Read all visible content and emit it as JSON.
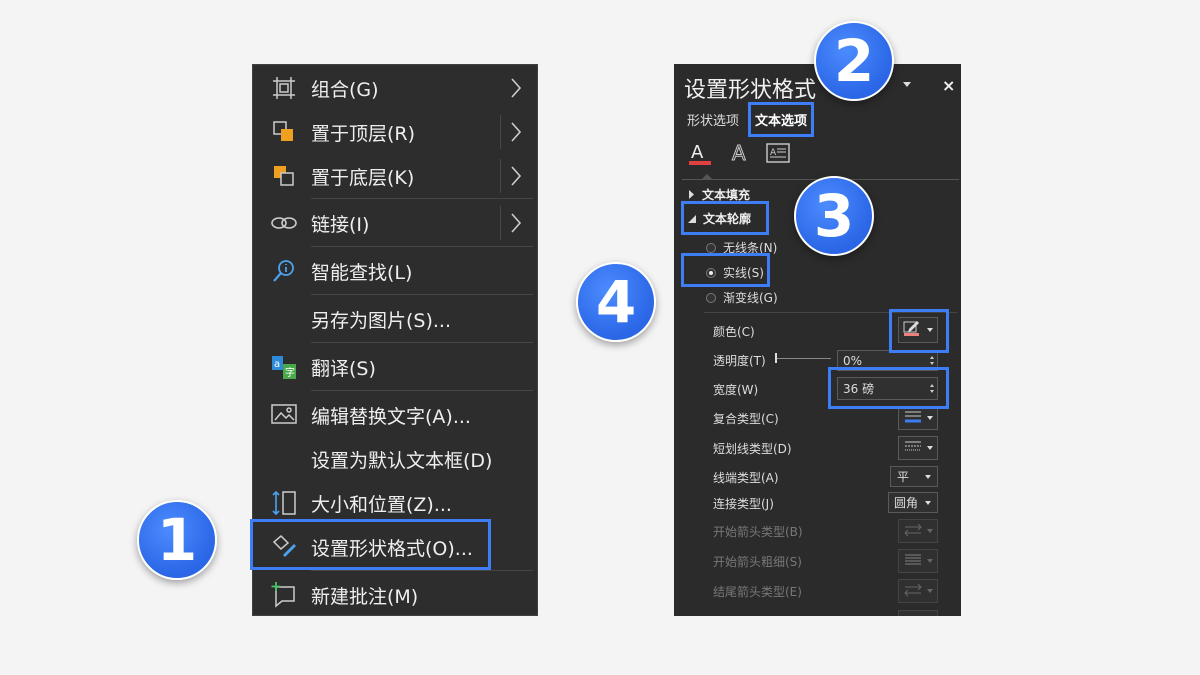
{
  "context_menu": {
    "items": [
      {
        "label": "组合(G)",
        "icon": "group-icon",
        "submenu": true
      },
      {
        "label": "置于顶层(R)",
        "icon": "bring-to-front-icon",
        "submenu": true
      },
      {
        "label": "置于底层(K)",
        "icon": "send-to-back-icon",
        "submenu": true
      },
      {
        "label": "链接(I)",
        "icon": "link-icon",
        "submenu": true
      },
      {
        "label": "智能查找(L)",
        "icon": "smart-lookup-icon",
        "submenu": false
      },
      {
        "label": "另存为图片(S)...",
        "icon": "",
        "submenu": false
      },
      {
        "label": "翻译(S)",
        "icon": "translate-icon",
        "submenu": false
      },
      {
        "label": "编辑替换文字(A)...",
        "icon": "alt-text-icon",
        "submenu": false
      },
      {
        "label": "设置为默认文本框(D)",
        "icon": "",
        "submenu": false
      },
      {
        "label": "大小和位置(Z)...",
        "icon": "size-position-icon",
        "submenu": false
      },
      {
        "label": "设置形状格式(O)...",
        "icon": "format-shape-icon",
        "submenu": false
      },
      {
        "label": "新建批注(M)",
        "icon": "new-comment-icon",
        "submenu": false
      }
    ]
  },
  "format_pane": {
    "title": "设置形状格式",
    "close": "×",
    "tabs": [
      {
        "label": "形状选项",
        "active": false
      },
      {
        "label": "文本选项",
        "active": true
      }
    ],
    "icons": [
      "text-fill-outline-icon",
      "text-effects-icon",
      "textbox-icon"
    ],
    "sections": {
      "text_fill": "文本填充",
      "text_outline": "文本轮廓"
    },
    "radios": [
      {
        "label": "无线条(N)",
        "checked": false
      },
      {
        "label": "实线(S)",
        "checked": true
      },
      {
        "label": "渐变线(G)",
        "checked": false
      }
    ],
    "props": {
      "color": {
        "label": "颜色(C)"
      },
      "transparency": {
        "label": "透明度(T)",
        "value": "0%"
      },
      "width": {
        "label": "宽度(W)",
        "value": "36 磅"
      },
      "compound": {
        "label": "复合类型(C)"
      },
      "dash": {
        "label": "短划线类型(D)"
      },
      "cap": {
        "label": "线端类型(A)",
        "value": "平"
      },
      "join": {
        "label": "连接类型(J)",
        "value": "圆角"
      },
      "begin_arrow_type": {
        "label": "开始箭头类型(B)"
      },
      "begin_arrow_size": {
        "label": "开始箭头粗细(S)"
      },
      "end_arrow_type": {
        "label": "结尾箭头类型(E)"
      }
    }
  },
  "step_badges": [
    "1",
    "2",
    "3",
    "4"
  ],
  "colors": {
    "highlight": "#3d7df5",
    "badge": "#2f6ff0",
    "outline_color_swatch": "#f08080"
  }
}
